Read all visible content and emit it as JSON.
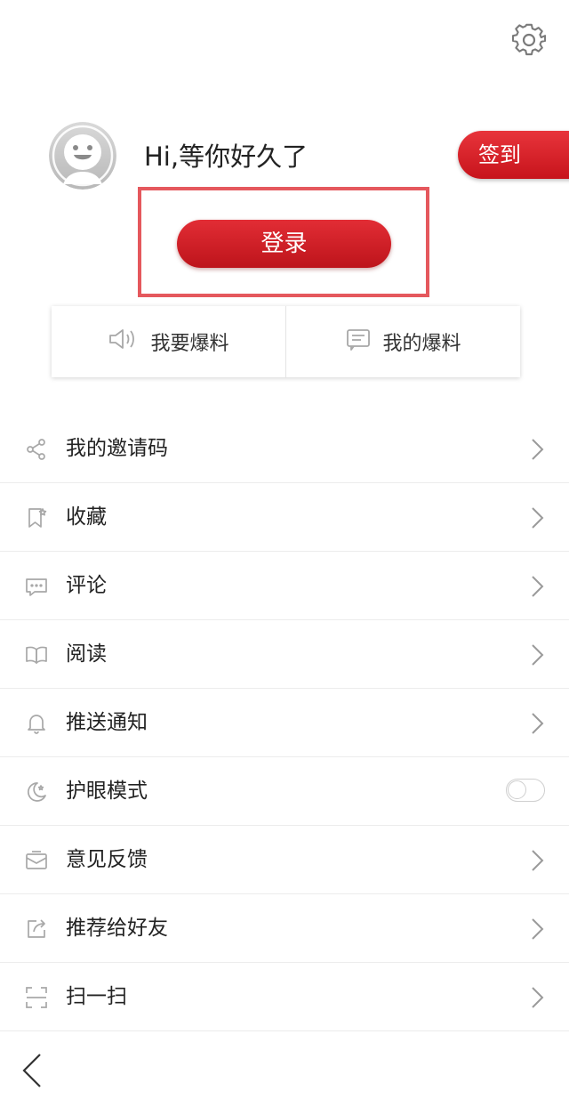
{
  "header": {
    "settings_icon": "gear-icon",
    "greeting": "Hi,等你好久了",
    "checkin_label": "签到",
    "login_label": "登录"
  },
  "colors": {
    "accent_red": "#d0181f",
    "highlight_border": "#e5585d",
    "divider": "#ececec",
    "icon_gray": "#a8a8a8"
  },
  "tips": [
    {
      "label": "我要爆料",
      "icon": "speaker-icon"
    },
    {
      "label": "我的爆料",
      "icon": "message-list-icon"
    }
  ],
  "menu": {
    "items": [
      {
        "label": "我的邀请码",
        "icon": "share-icon"
      },
      {
        "label": "收藏",
        "icon": "bookmark-star-icon"
      },
      {
        "label": "评论",
        "icon": "comment-icon"
      },
      {
        "label": "阅读",
        "icon": "book-icon"
      },
      {
        "label": "推送通知",
        "icon": "bell-icon"
      },
      {
        "label": "护眼模式",
        "icon": "moon-icon",
        "toggle": false
      },
      {
        "label": "意见反馈",
        "icon": "mail-icon"
      },
      {
        "label": "推荐给好友",
        "icon": "forward-icon"
      },
      {
        "label": "扫一扫",
        "icon": "scan-icon"
      }
    ]
  },
  "nav": {
    "back_icon": "back-arrow-icon"
  }
}
